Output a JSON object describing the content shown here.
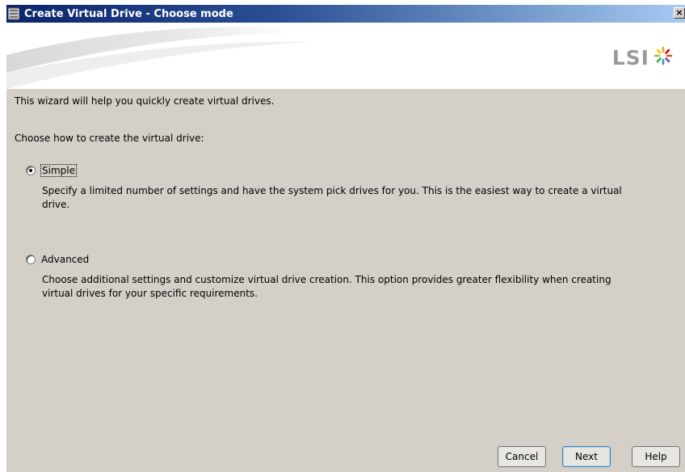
{
  "window": {
    "title": "Create Virtual Drive - Choose mode",
    "close_glyph": "×"
  },
  "banner": {
    "logo_text": "LSI"
  },
  "content": {
    "intro": "This wizard will help you quickly create virtual drives.",
    "choose_label": "Choose how to create the virtual drive:",
    "options": [
      {
        "label": "Simple",
        "selected": true,
        "description": "Specify a limited number of settings and have the system pick drives for you. This is the easiest way to create a virtual drive."
      },
      {
        "label": "Advanced",
        "selected": false,
        "description": "Choose additional settings and customize virtual drive creation. This option provides greater flexibility when creating virtual drives for your specific requirements."
      }
    ]
  },
  "buttons": {
    "cancel": "Cancel",
    "next": "Next",
    "help": "Help"
  },
  "colors": {
    "titlebar": "#0a246a",
    "dialog_bg": "#d4d0c8",
    "logo_accent": "#f0a020"
  }
}
